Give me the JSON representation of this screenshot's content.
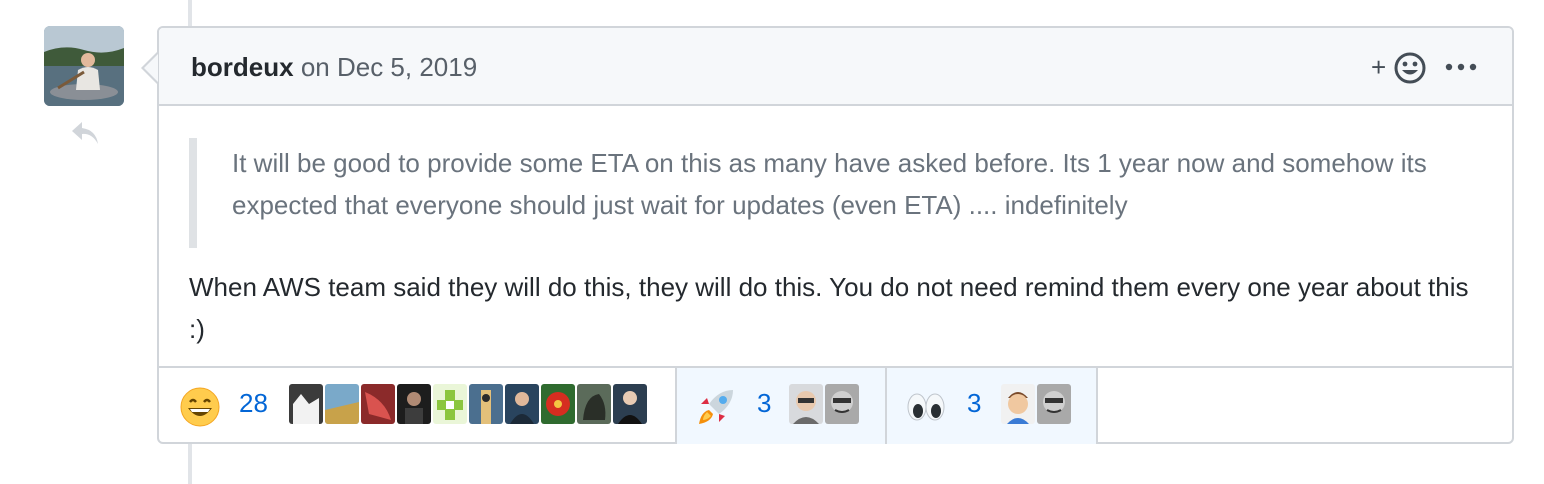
{
  "comment": {
    "author": "bordeux",
    "timestamp": "on Dec 5, 2019",
    "quote": "It will be good to provide some ETA on this as many have asked before. Its 1 year now and somehow its expected that everyone should just wait for updates (even ETA) .... indefinitely",
    "body": "When AWS team said they will do this, they will do this. You do not need remind them every one year about this :)",
    "add_reaction_label": "+",
    "icons": {
      "reply": "reply-icon",
      "add_reaction": "smiley-icon",
      "more": "kebab-horizontal-icon"
    }
  },
  "reactions": [
    {
      "emoji": "smile-emoji",
      "count": "28",
      "avatars": [
        "#3b3b3b",
        "#7aa9c9",
        "#8b2a2a",
        "#1d1d1d",
        "#a5d66a",
        "#4b6f8f",
        "#29445e",
        "#c0392b",
        "#5b6b5a",
        "#2c3e50"
      ]
    },
    {
      "emoji": "rocket-emoji",
      "count": "3",
      "avatars": [
        "#9aa0a6",
        "#6f6f6f"
      ]
    },
    {
      "emoji": "eyes-emoji",
      "count": "3",
      "avatars": [
        "#c89b7b",
        "#6f6f6f"
      ]
    }
  ],
  "colors": {
    "link": "#0366d6",
    "border": "#d1d5da",
    "header_bg": "#f6f8fa",
    "reaction_active_bg": "#f1f8ff"
  }
}
